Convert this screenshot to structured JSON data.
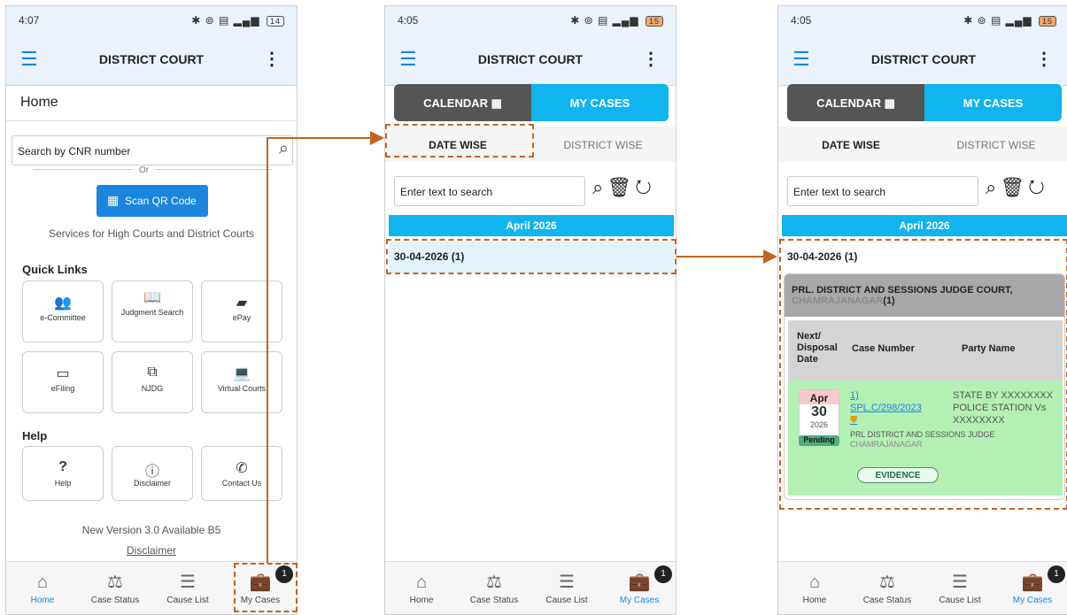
{
  "app_title": "DISTRICT COURT",
  "nav": [
    {
      "label": "Home",
      "icon": "home-icon"
    },
    {
      "label": "Case Status",
      "icon": "scales-icon"
    },
    {
      "label": "Cause List",
      "icon": "list-icon"
    },
    {
      "label": "My Cases",
      "icon": "briefcase-icon",
      "badge": "1"
    }
  ],
  "phone1": {
    "time": "4:07",
    "battery": "14",
    "page_title": "Home",
    "search_placeholder": "Search by CNR number",
    "or": "Or",
    "scan_qr": "Scan QR Code",
    "services": "Services for High Courts and District Courts",
    "quick_links_title": "Quick Links",
    "quick_links": [
      "e-Committee",
      "Judgment Search",
      "ePay",
      "eFiling",
      "NJDG",
      "Virtual Courts"
    ],
    "help_title": "Help",
    "help_links": [
      "Help",
      "Disclaimer",
      "Contact Us"
    ],
    "version": "New Version 3.0 Available B5",
    "disclaimer": "Disclaimer"
  },
  "phone2": {
    "time": "4:05",
    "battery": "15",
    "calendar": "CALENDAR",
    "my_cases": "MY CASES",
    "date_wise": "DATE WISE",
    "district_wise": "DISTRICT WISE",
    "filter_placeholder": "Enter text to search",
    "month": "April 2026",
    "date_row": "30-04-2026 (1)"
  },
  "phone3": {
    "time": "4:05",
    "battery": "15",
    "calendar": "CALENDAR",
    "my_cases": "MY CASES",
    "date_wise": "DATE WISE",
    "district_wise": "DISTRICT WISE",
    "filter_placeholder": "Enter text to search",
    "month": "April 2026",
    "date_row": "30-04-2026 (1)",
    "court_name": "PRL. DISTRICT AND SESSIONS JUDGE COURT,",
    "court_city": "CHAMRAJANAGAR",
    "court_count": "(1)",
    "col_date": "Next/ Disposal Date",
    "col_case": "Case Number",
    "col_party": "Party Name",
    "month_abbr": "Apr",
    "day": "30",
    "year": "2026",
    "status": "Pending",
    "case_index": "1)",
    "case_number": "SPL.C/298/2023",
    "court_short": "PRL DISTRICT AND SESSIONS JUDGE",
    "court_short_city": "CHAMRAJANAGAR",
    "party": "STATE BY XXXXXXXX POLICE STATION Vs XXXXXXXX",
    "stage": "EVIDENCE"
  }
}
